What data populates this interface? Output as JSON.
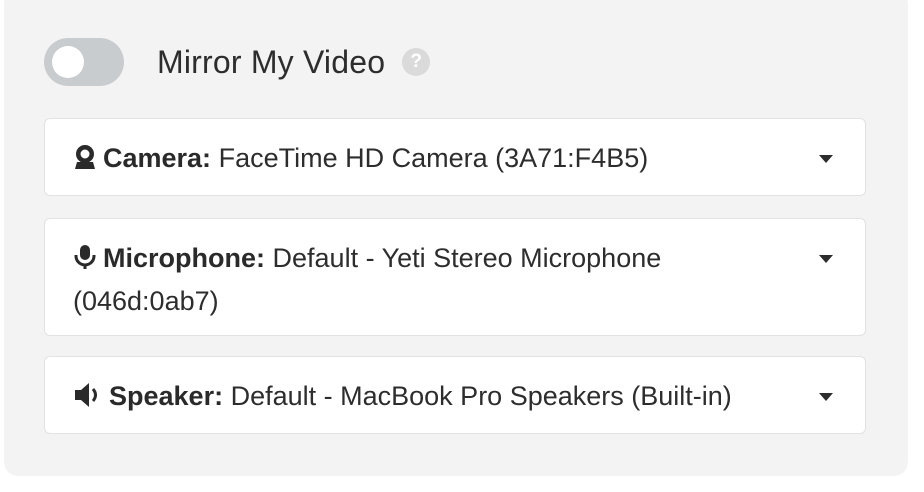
{
  "mirror": {
    "label": "Mirror My Video",
    "enabled": false,
    "help_glyph": "?"
  },
  "camera": {
    "label": "Camera:",
    "value": "FaceTime HD Camera (3A71:F4B5)",
    "icon": "webcam-icon"
  },
  "microphone": {
    "label": "Microphone:",
    "value": "Default - Yeti Stereo Microphone (046d:0ab7)",
    "icon": "microphone-icon"
  },
  "speaker": {
    "label": "Speaker:",
    "value": "Default - MacBook Pro Speakers (Built-in)",
    "icon": "speaker-icon"
  },
  "colors": {
    "panel_bg": "#f3f3f4",
    "toggle_off": "#c9cccf",
    "text": "#2d2d2d",
    "help_icon_bg": "#dadada"
  }
}
